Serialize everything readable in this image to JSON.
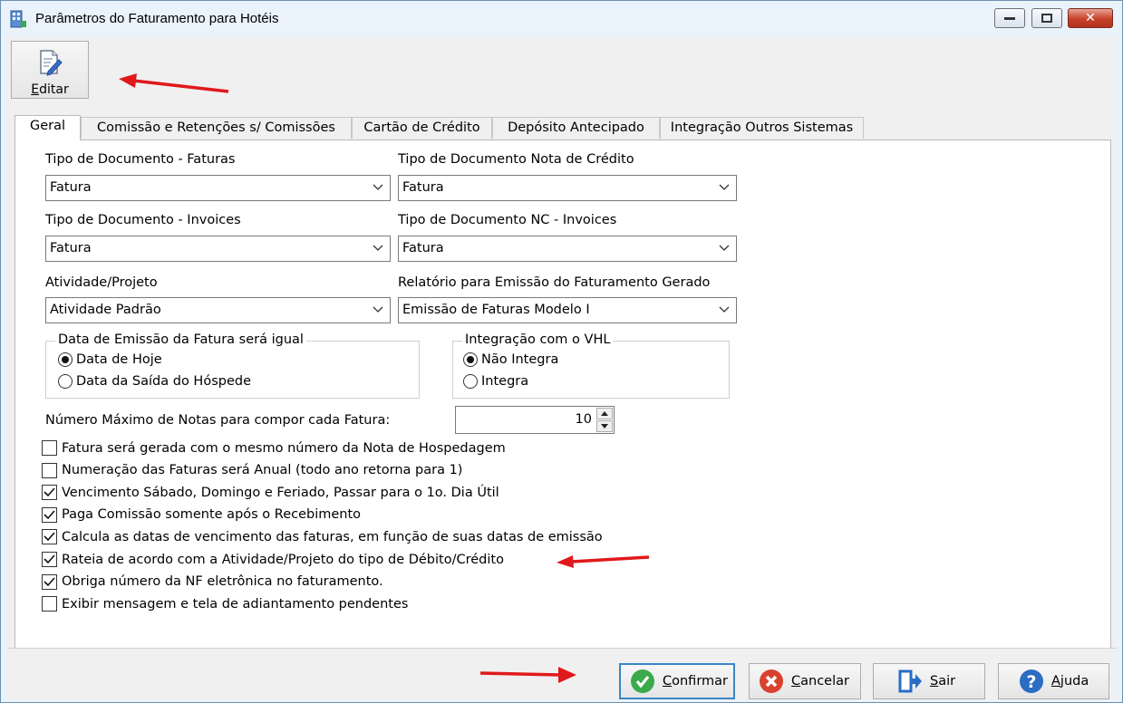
{
  "window": {
    "title": "Parâmetros do Faturamento para Hotéis",
    "close_glyph": "✕"
  },
  "toolbar": {
    "edit_label_first": "E",
    "edit_label_rest": "ditar"
  },
  "tabs": [
    {
      "label": "Geral",
      "active": true
    },
    {
      "label": "Comissão e Retenções s/ Comissões"
    },
    {
      "label": "Cartão de Crédito"
    },
    {
      "label": "Depósito Antecipado"
    },
    {
      "label": "Integração Outros Sistemas"
    }
  ],
  "fields": {
    "tipo_doc_faturas": {
      "label": "Tipo de Documento - Faturas",
      "value": "Fatura"
    },
    "tipo_doc_nota_credito": {
      "label": "Tipo de Documento Nota de Crédito",
      "value": "Fatura"
    },
    "tipo_doc_invoices": {
      "label": "Tipo de Documento - Invoices",
      "value": "Fatura"
    },
    "tipo_doc_nc_invoices": {
      "label": "Tipo de Documento NC - Invoices",
      "value": "Fatura"
    },
    "atividade_projeto": {
      "label": "Atividade/Projeto",
      "value": "Atividade Padrão"
    },
    "relatorio_emissao": {
      "label": "Relatório para Emissão do Faturamento Gerado",
      "value": "Emissão de Faturas Modelo I"
    }
  },
  "group_data_emissao": {
    "title": "Data de Emissão da Fatura será igual",
    "options": [
      "Data de Hoje",
      "Data da Saída do Hóspede"
    ],
    "selected": 0
  },
  "group_vhl": {
    "title": "Integração com o VHL",
    "options": [
      "Não Integra",
      "Integra"
    ],
    "selected": 0
  },
  "max_notas": {
    "label": "Número Máximo de Notas para compor cada Fatura:",
    "value": "10"
  },
  "checkboxes": [
    {
      "label": "Fatura será gerada com o mesmo número da Nota de Hospedagem",
      "checked": false
    },
    {
      "label": "Numeração das Faturas será Anual (todo ano retorna para 1)",
      "checked": false
    },
    {
      "label": "Vencimento Sábado, Domingo e Feriado, Passar para o 1o. Dia Útil",
      "checked": true
    },
    {
      "label": "Paga Comissão somente após o Recebimento",
      "checked": true
    },
    {
      "label": "Calcula as datas de vencimento das faturas,  em função de suas datas de emissão",
      "checked": true
    },
    {
      "label": "Rateia de acordo com a Atividade/Projeto do tipo de Débito/Crédito",
      "checked": true
    },
    {
      "label": "Obriga número da NF eletrônica no faturamento.",
      "checked": true
    },
    {
      "label": "Exibir mensagem e tela de adiantamento pendentes",
      "checked": false
    }
  ],
  "buttons": {
    "confirmar": {
      "first": "C",
      "rest": "onfirmar"
    },
    "cancelar": {
      "first": "C",
      "rest": "ancelar"
    },
    "sair": {
      "first": "S",
      "rest": "air"
    },
    "ajuda": {
      "first": "A",
      "rest": "juda"
    }
  },
  "colors": {
    "accent": "#3a86c8",
    "annotation_arrow": "#e0191b",
    "confirm_green": "#3aaa4a",
    "cancel_red": "#d9412e",
    "help_blue": "#2b6cc4"
  }
}
